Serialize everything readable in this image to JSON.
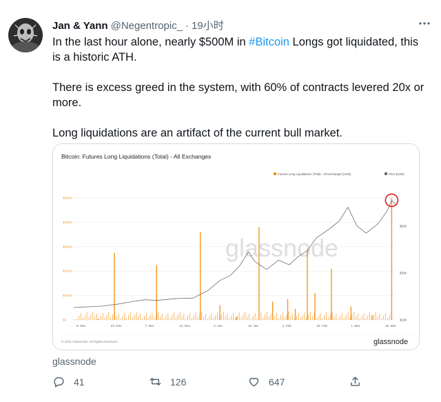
{
  "tweet": {
    "author_name": "Jan & Yann",
    "author_handle": "@Negentropic_",
    "separator": "·",
    "time": "19小时",
    "more_icon": "more-horizontal-icon",
    "text_line1_before": "In the last hour alone, nearly $500M in ",
    "hashtag": "#Bitcoin",
    "text_line1_after": " Longs got liquidated, this is a historic ATH.",
    "text_para2": "There is excess greed in the system, with 60% of contracts levered 20x or more.",
    "text_para3": "Long liquidations are an artifact of the current bull market.",
    "card_source": "glassnode",
    "replies": "41",
    "retweets": "126",
    "likes": "647"
  },
  "chart_data": {
    "type": "bar",
    "title": "Bitcoin: Futures Long Liquidations (Total) - All Exchanges",
    "legend": [
      "Futures Long Liquidations (Total) - All Exchanges [USD]",
      "Price [USD]"
    ],
    "legend_position": "top-right",
    "watermark": "glassnode",
    "footer_left": "© 2021 Glassnode. All Rights Reserved.",
    "footer_logo": "glassnode",
    "x_tick_labels": [
      "9. Nov",
      "23. Nov",
      "7. Dec",
      "21. Dec",
      "4. Jan",
      "18. Jan",
      "1. Feb",
      "15. Feb",
      "1. Mar",
      "15. Mar"
    ],
    "y_left_tick_labels": [
      "$0",
      "$100m",
      "$200m",
      "$300m",
      "$400m",
      "$500m"
    ],
    "y_left_range": [
      0,
      500
    ],
    "y_left_unit": "million USD",
    "y_right_tick_labels": [
      "$10k",
      "$30k",
      "$50k"
    ],
    "y_right_range": [
      10000,
      62000
    ],
    "liquidation_spikes": [
      {
        "x": 0.0,
        "value": 0
      },
      {
        "x": 0.16,
        "value": 4
      },
      {
        "x": 0.27,
        "value": 275
      },
      {
        "x": 0.55,
        "value": 225
      },
      {
        "x": 0.84,
        "value": 360
      },
      {
        "x": 0.97,
        "value": 60
      },
      {
        "x": 1.08,
        "value": 12
      },
      {
        "x": 1.23,
        "value": 380
      },
      {
        "x": 1.32,
        "value": 75
      },
      {
        "x": 1.42,
        "value": 85
      },
      {
        "x": 1.47,
        "value": 45
      },
      {
        "x": 1.55,
        "value": 290
      },
      {
        "x": 1.6,
        "value": 110
      },
      {
        "x": 1.71,
        "value": 210
      },
      {
        "x": 1.84,
        "value": 55
      },
      {
        "x": 1.98,
        "value": 20
      },
      {
        "x": 2.11,
        "value": 500
      }
    ],
    "price_series": [
      {
        "x": 0.0,
        "value": 15300
      },
      {
        "x": 0.19,
        "value": 15900
      },
      {
        "x": 0.29,
        "value": 16700
      },
      {
        "x": 0.39,
        "value": 17800
      },
      {
        "x": 0.47,
        "value": 18600
      },
      {
        "x": 0.55,
        "value": 18300
      },
      {
        "x": 0.68,
        "value": 19100
      },
      {
        "x": 0.79,
        "value": 19300
      },
      {
        "x": 0.89,
        "value": 22500
      },
      {
        "x": 0.97,
        "value": 26800
      },
      {
        "x": 1.04,
        "value": 29000
      },
      {
        "x": 1.1,
        "value": 33000
      },
      {
        "x": 1.16,
        "value": 39000
      },
      {
        "x": 1.2,
        "value": 35000
      },
      {
        "x": 1.28,
        "value": 31500
      },
      {
        "x": 1.36,
        "value": 35500
      },
      {
        "x": 1.43,
        "value": 33500
      },
      {
        "x": 1.49,
        "value": 37000
      },
      {
        "x": 1.55,
        "value": 39500
      },
      {
        "x": 1.61,
        "value": 45000
      },
      {
        "x": 1.69,
        "value": 48500
      },
      {
        "x": 1.76,
        "value": 52000
      },
      {
        "x": 1.82,
        "value": 58000
      },
      {
        "x": 1.88,
        "value": 50000
      },
      {
        "x": 1.94,
        "value": 47000
      },
      {
        "x": 2.02,
        "value": 51000
      },
      {
        "x": 2.08,
        "value": 56500
      },
      {
        "x": 2.11,
        "value": 61000
      },
      {
        "x": 2.14,
        "value": 59000
      }
    ],
    "highlight_annotation": "red circle around latest price peak",
    "colors": {
      "bars": "#f7931a",
      "price_line": "#6e6e6e",
      "highlight": "#e0191b",
      "grid": "#e8e8e8",
      "watermark": "#dcdcdc"
    }
  },
  "colors": {
    "text": "#0f1419",
    "secondary": "#536471",
    "link": "#1d9bf0",
    "border": "#cfd9de"
  },
  "icons": {
    "reply": "reply-icon",
    "retweet": "retweet-icon",
    "like": "like-icon",
    "share": "share-icon"
  }
}
